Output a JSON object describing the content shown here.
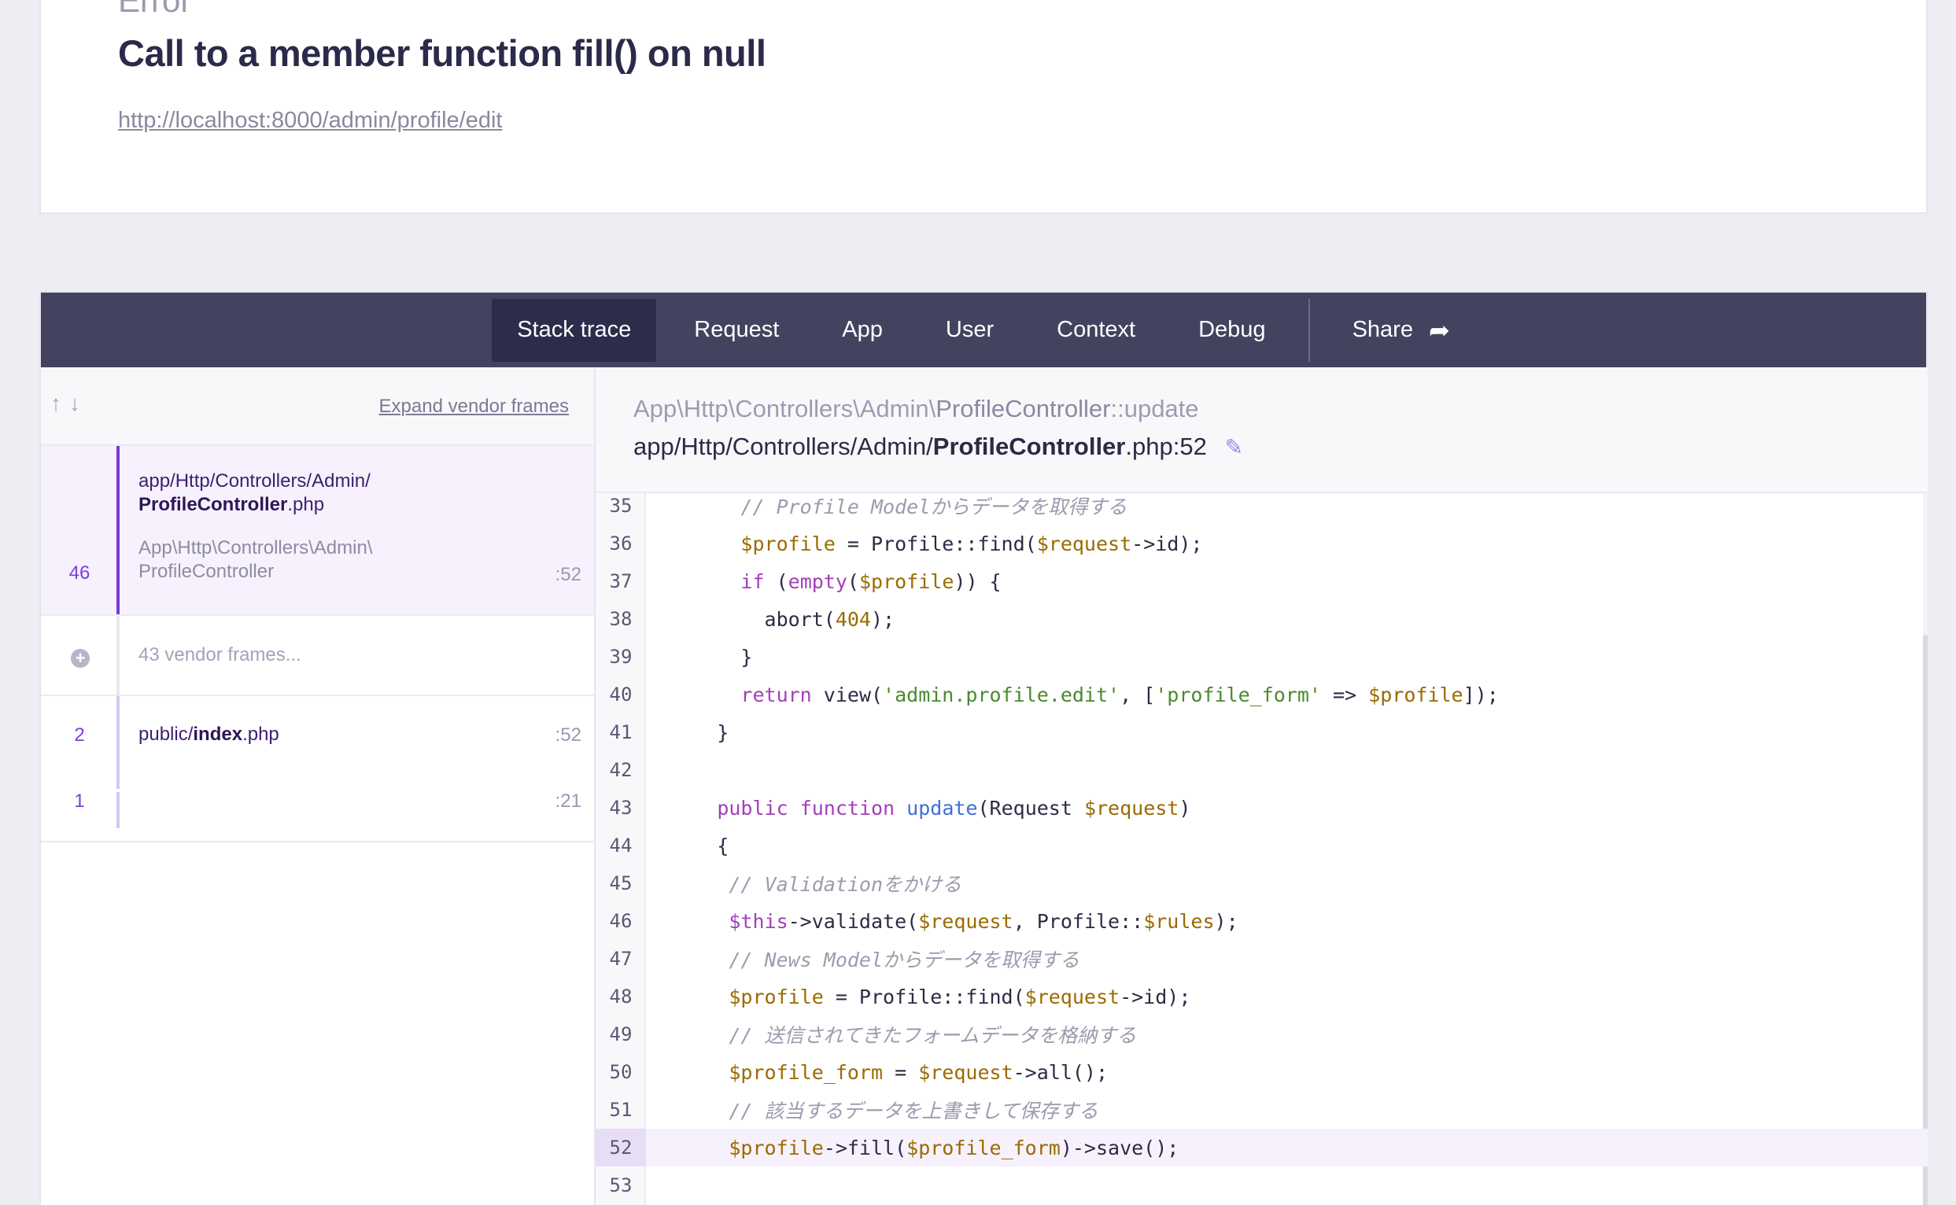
{
  "error": {
    "label": "Error",
    "title": "Call to a member function fill() on null",
    "url": "http://localhost:8000/admin/profile/edit"
  },
  "tabs": [
    {
      "label": "Stack trace",
      "active": true
    },
    {
      "label": "Request",
      "active": false
    },
    {
      "label": "App",
      "active": false
    },
    {
      "label": "User",
      "active": false
    },
    {
      "label": "Context",
      "active": false
    },
    {
      "label": "Debug",
      "active": false
    }
  ],
  "share": {
    "label": "Share",
    "icon": "share-arrow-icon"
  },
  "sidebar": {
    "expand_vendor_label": "Expand vendor frames",
    "frames": [
      {
        "number": "46",
        "file_prefix": "app/Http/Controllers/Admin/",
        "file_name": "ProfileController",
        "file_ext": ".php",
        "class_line1": "App\\Http\\Controllers\\Admin\\",
        "class_line2": "ProfileController",
        "line": ":52"
      },
      {
        "vendor_label": "43 vendor frames..."
      },
      {
        "number": "2",
        "file_prefix": "public/",
        "file_name": "index",
        "file_ext": ".php",
        "line": ":52"
      },
      {
        "number": "1",
        "line": ":21"
      }
    ]
  },
  "code_header": {
    "namespace_prefix": "App\\Http\\Controllers\\Admin\\",
    "namespace_class": "ProfileController",
    "namespace_method": "::update",
    "path_prefix": "app/Http/Controllers/Admin/",
    "path_file": "ProfileController",
    "path_suffix": ".php:52"
  },
  "code": {
    "highlight_line": 52,
    "lines": [
      {
        "n": "35",
        "text": "        // Profile Modelからデータを取得する"
      },
      {
        "n": "36",
        "text": "        $profile = Profile::find($request->id);"
      },
      {
        "n": "37",
        "text": "        if (empty($profile)) {"
      },
      {
        "n": "38",
        "text": "          abort(404);"
      },
      {
        "n": "39",
        "text": "        }"
      },
      {
        "n": "40",
        "text": "        return view('admin.profile.edit', ['profile_form' => $profile]);"
      },
      {
        "n": "41",
        "text": "      }"
      },
      {
        "n": "42",
        "text": ""
      },
      {
        "n": "43",
        "text": "      public function update(Request $request)"
      },
      {
        "n": "44",
        "text": "      {"
      },
      {
        "n": "45",
        "text": "       // Validationをかける"
      },
      {
        "n": "46",
        "text": "       $this->validate($request, Profile::$rules);"
      },
      {
        "n": "47",
        "text": "       // News Modelからデータを取得する"
      },
      {
        "n": "48",
        "text": "       $profile = Profile::find($request->id);"
      },
      {
        "n": "49",
        "text": "       // 送信されてきたフォームデータを格納する"
      },
      {
        "n": "50",
        "text": "       $profile_form = $request->all();"
      },
      {
        "n": "51",
        "text": "       // 該当するデータを上書きして保存する"
      },
      {
        "n": "52",
        "text": "       $profile->fill($profile_form)->save();"
      },
      {
        "n": "53",
        "text": ""
      }
    ]
  },
  "colors": {
    "tabbar_bg": "#44435f",
    "active_tab_bg": "#2e2c4b",
    "accent_purple": "#7b3ad6",
    "page_bg": "#eeedf3"
  }
}
